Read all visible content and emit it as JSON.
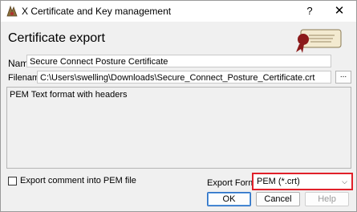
{
  "window": {
    "title": "X Certificate and Key management",
    "help_glyph": "?",
    "close_glyph": "✕"
  },
  "header": {
    "title": "Certificate export"
  },
  "form": {
    "name_label": "Name",
    "name_value": "Secure Connect Posture Certificate",
    "filename_label": "Filename",
    "filename_value": "C:\\Users\\swelling\\Downloads\\Secure_Connect_Posture_Certificate.crt",
    "browse_label": "...",
    "description": "PEM Text format with headers",
    "export_comment_label": "Export comment into PEM file",
    "export_comment_checked": false,
    "export_format_label": "Export Format",
    "export_format_value": "PEM (*.crt)"
  },
  "buttons": {
    "ok": "OK",
    "cancel": "Cancel",
    "help": "Help"
  },
  "colors": {
    "highlight": "#e0202a",
    "default_button_border": "#2d6fc2"
  }
}
